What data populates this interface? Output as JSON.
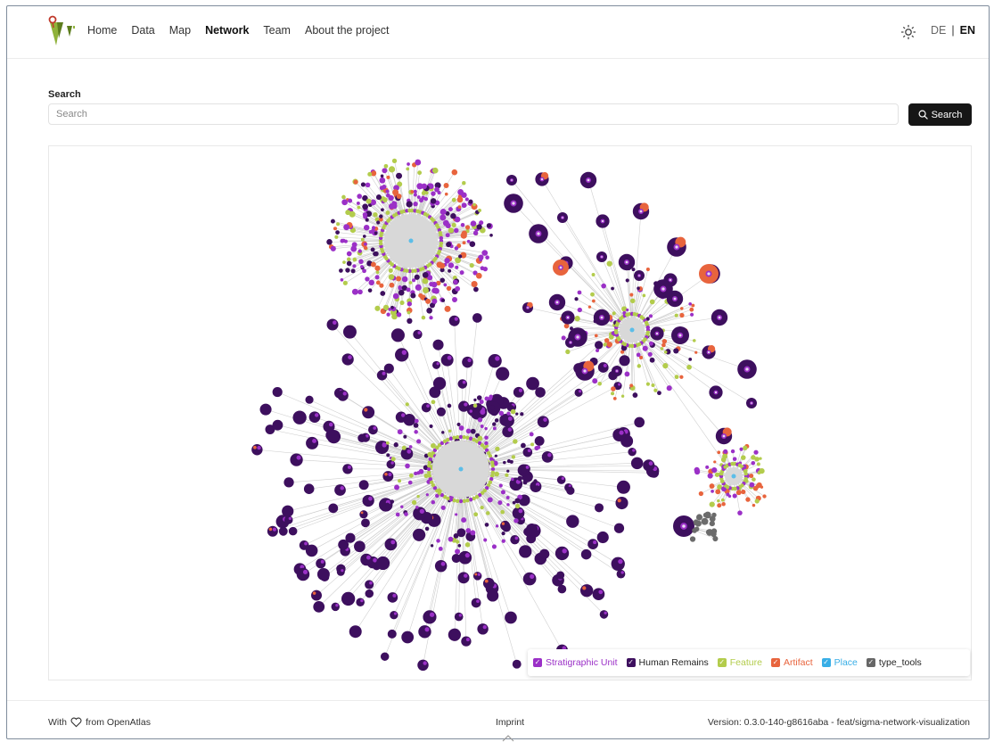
{
  "nav": {
    "links": [
      "Home",
      "Data",
      "Map",
      "Network",
      "Team",
      "About the project"
    ],
    "active": "Network",
    "lang_de": "DE",
    "lang_sep": "|",
    "lang_en": "EN"
  },
  "search": {
    "label": "Search",
    "placeholder": "Search",
    "value": "",
    "button_label": "Search"
  },
  "network": {
    "legend": [
      {
        "label": "Stratigraphic Unit",
        "color": "#9b30c7",
        "checked": true
      },
      {
        "label": "Human Remains",
        "color": "#3d0f5e",
        "checked": true
      },
      {
        "label": "Feature",
        "color": "#b3cc4c",
        "checked": true
      },
      {
        "label": "Artifact",
        "color": "#e8643d",
        "checked": true
      },
      {
        "label": "Place",
        "color": "#38aee6",
        "checked": true
      },
      {
        "label": "type_tools",
        "color": "#666666",
        "checked": true
      }
    ]
  },
  "footer": {
    "with": "With",
    "from": "from OpenAtlas",
    "imprint": "Imprint",
    "version": "Version: 0.3.0-140-g8616aba - feat/sigma-network-visualization"
  },
  "colors": {
    "stratigraphic": "#9b30c7",
    "human": "#3d0f5e",
    "feature": "#b3cc4c",
    "artifact": "#e8643d",
    "place": "#5bbde8",
    "tools": "#6b6b6b",
    "edge": "#cfcfcf"
  }
}
